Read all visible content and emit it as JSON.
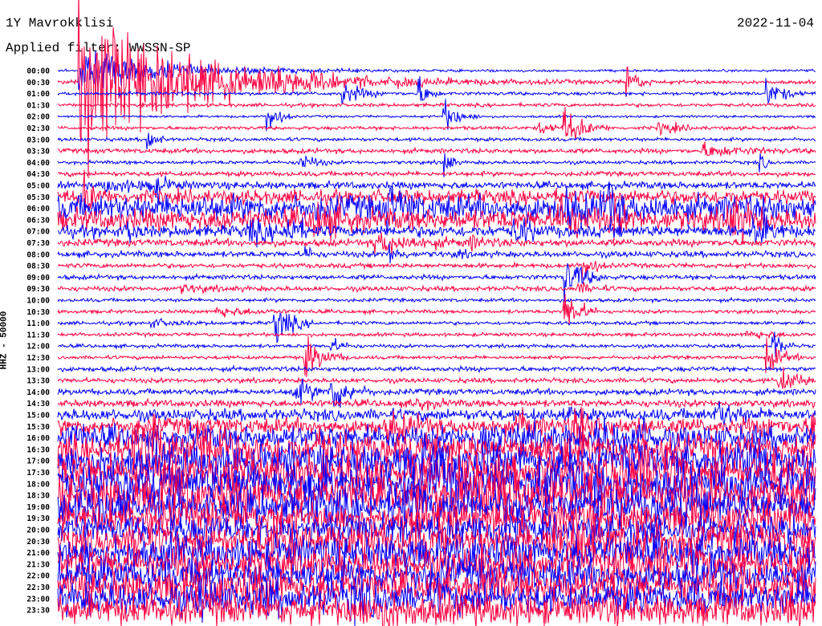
{
  "header": {
    "station": "1Y Mavrokklisi",
    "filter": "Applied filter: WWSSN-SP",
    "date": "2022-11-04"
  },
  "chart_data": {
    "type": "line",
    "title": "1Y Mavrokklisi 2022-11-04",
    "ylabel": "HHZ - 50000",
    "xlabel": "",
    "minutes_per_row": 30,
    "colors": [
      "#0000ff",
      "#ff0040"
    ],
    "row_labels": [
      "00:00",
      "00:30",
      "01:00",
      "01:30",
      "02:00",
      "02:30",
      "03:00",
      "03:30",
      "04:00",
      "04:30",
      "05:00",
      "05:30",
      "06:00",
      "06:30",
      "07:00",
      "07:30",
      "08:00",
      "08:30",
      "09:00",
      "09:30",
      "10:00",
      "10:30",
      "11:00",
      "11:30",
      "12:00",
      "12:30",
      "13:00",
      "13:30",
      "14:00",
      "14:30",
      "15:00",
      "15:30",
      "16:00",
      "16:30",
      "17:00",
      "17:30",
      "18:00",
      "18:30",
      "19:00",
      "19:30",
      "20:00",
      "20:30",
      "21:00",
      "21:30",
      "22:00",
      "22:30",
      "23:00",
      "23:30"
    ],
    "noise_level": [
      0.2,
      0.3,
      0.3,
      0.3,
      0.2,
      0.3,
      0.3,
      0.4,
      0.3,
      0.4,
      0.6,
      1.2,
      2.2,
      1.8,
      1.0,
      0.6,
      0.5,
      0.4,
      0.4,
      0.4,
      0.3,
      0.3,
      0.3,
      0.3,
      0.3,
      0.3,
      0.4,
      0.4,
      0.5,
      0.6,
      1.0,
      1.4,
      2.0,
      2.4,
      2.8,
      3.0,
      3.2,
      3.2,
      3.0,
      2.6,
      2.4,
      2.6,
      2.8,
      2.8,
      2.8,
      2.8,
      2.6,
      2.6
    ],
    "spike_rate": [
      0,
      0.02,
      0.02,
      0.02,
      0.02,
      0.03,
      0.03,
      0.04,
      0.04,
      0.04,
      0.05,
      0.08,
      0.12,
      0.1,
      0.08,
      0.06,
      0.04,
      0.03,
      0.03,
      0.02,
      0.02,
      0.02,
      0.02,
      0.02,
      0.02,
      0.02,
      0.03,
      0.04,
      0.05,
      0.06,
      0.1,
      0.14,
      0.2,
      0.22,
      0.25,
      0.25,
      0.25,
      0.25,
      0.25,
      0.22,
      0.2,
      0.22,
      0.22,
      0.22,
      0.22,
      0.22,
      0.22,
      0.22
    ],
    "events": [
      {
        "row": 1,
        "minute": 0.8,
        "amplitude": 14,
        "duration": 4
      },
      {
        "row": 0,
        "minute": 0.8,
        "amplitude": 4,
        "duration": 3
      },
      {
        "row": 7,
        "minute": 25.5,
        "amplitude": 1.3,
        "duration": 1.2
      },
      {
        "row": 19,
        "minute": 4.8,
        "amplitude": 0.7,
        "duration": 1.0
      },
      {
        "row": 21,
        "minute": 6.2,
        "amplitude": 1.0,
        "duration": 1.2
      },
      {
        "row": 22,
        "minute": 3.6,
        "amplitude": 0.8,
        "duration": 0.8
      },
      {
        "row": 23,
        "minute": 27.2,
        "amplitude": 0.8,
        "duration": 1.0
      },
      {
        "row": 15,
        "minute": 12.5,
        "amplitude": 2.0,
        "duration": 1.5
      },
      {
        "row": 10,
        "minute": 1.8,
        "amplitude": 1.2,
        "duration": 1.2
      }
    ]
  }
}
